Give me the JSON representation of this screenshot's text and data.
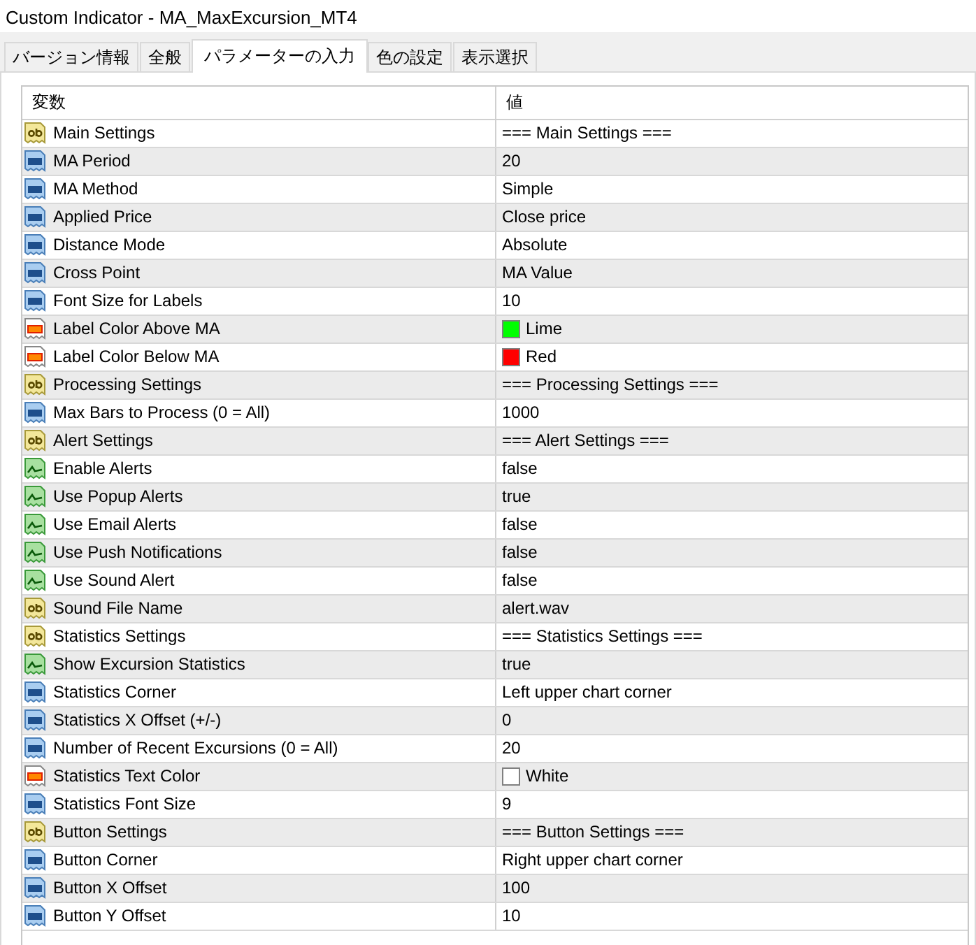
{
  "window": {
    "title": "Custom Indicator - MA_MaxExcursion_MT4"
  },
  "tabs": [
    {
      "label": "バージョン情報",
      "selected": false
    },
    {
      "label": "全般",
      "selected": false
    },
    {
      "label": "パラメーターの入力",
      "selected": true
    },
    {
      "label": "色の設定",
      "selected": false
    },
    {
      "label": "表示選択",
      "selected": false
    }
  ],
  "table": {
    "columns": [
      "変数",
      "値"
    ],
    "rows": [
      {
        "kind": "string",
        "name": "Main Settings",
        "value": "=== Main Settings ==="
      },
      {
        "kind": "number",
        "name": "MA Period",
        "value": "20"
      },
      {
        "kind": "number",
        "name": "MA Method",
        "value": "Simple"
      },
      {
        "kind": "number",
        "name": "Applied Price",
        "value": "Close price"
      },
      {
        "kind": "number",
        "name": "Distance Mode",
        "value": "Absolute"
      },
      {
        "kind": "number",
        "name": "Cross Point",
        "value": "MA Value"
      },
      {
        "kind": "number",
        "name": "Font Size for Labels",
        "value": "10"
      },
      {
        "kind": "color",
        "name": "Label Color Above MA",
        "value": "Lime",
        "color": "#00ff00"
      },
      {
        "kind": "color",
        "name": "Label Color Below MA",
        "value": "Red",
        "color": "#ff0000"
      },
      {
        "kind": "string",
        "name": "Processing Settings",
        "value": "=== Processing Settings ==="
      },
      {
        "kind": "number",
        "name": "Max Bars to Process (0 = All)",
        "value": "1000"
      },
      {
        "kind": "string",
        "name": "Alert Settings",
        "value": "=== Alert Settings ==="
      },
      {
        "kind": "bool",
        "name": "Enable Alerts",
        "value": "false"
      },
      {
        "kind": "bool",
        "name": "Use Popup Alerts",
        "value": "true"
      },
      {
        "kind": "bool",
        "name": "Use Email Alerts",
        "value": "false"
      },
      {
        "kind": "bool",
        "name": "Use Push Notifications",
        "value": "false"
      },
      {
        "kind": "bool",
        "name": "Use Sound Alert",
        "value": "false"
      },
      {
        "kind": "string",
        "name": "Sound File Name",
        "value": "alert.wav"
      },
      {
        "kind": "string",
        "name": "Statistics Settings",
        "value": "=== Statistics Settings ==="
      },
      {
        "kind": "bool",
        "name": "Show Excursion Statistics",
        "value": "true"
      },
      {
        "kind": "number",
        "name": "Statistics Corner",
        "value": "Left upper chart corner"
      },
      {
        "kind": "number",
        "name": "Statistics X Offset (+/-)",
        "value": "0"
      },
      {
        "kind": "number",
        "name": "Number of Recent Excursions (0 = All)",
        "value": "20"
      },
      {
        "kind": "color",
        "name": "Statistics Text Color",
        "value": "White",
        "color": "#ffffff"
      },
      {
        "kind": "number",
        "name": "Statistics Font Size",
        "value": "9"
      },
      {
        "kind": "string",
        "name": "Button Settings",
        "value": "=== Button Settings ==="
      },
      {
        "kind": "number",
        "name": "Button Corner",
        "value": "Right upper chart corner"
      },
      {
        "kind": "number",
        "name": "Button X Offset",
        "value": "100"
      },
      {
        "kind": "number",
        "name": "Button Y Offset",
        "value": "10"
      }
    ]
  }
}
